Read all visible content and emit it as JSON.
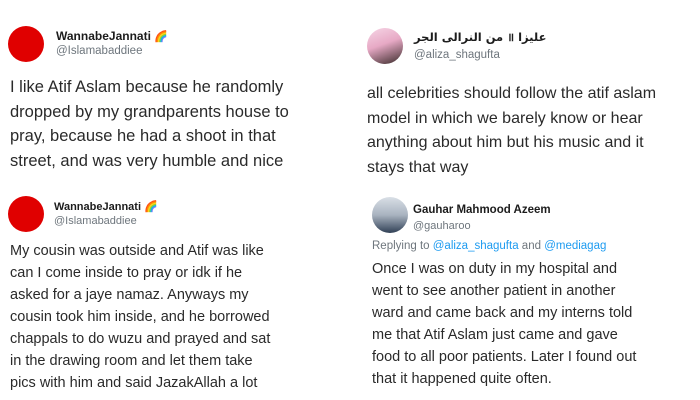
{
  "tweets": [
    {
      "name": "WannabeJannati",
      "badge": "🌈",
      "handle": "@Islamabaddiee",
      "lines": [
        "I like Atif Aslam because he randomly",
        "dropped by my grandparents house to",
        "pray, because he had a shoot in that",
        "street, and was very humble and nice"
      ]
    },
    {
      "name": "علیزا ॥ من النرالی الجر",
      "handle": "@aliza_shagufta",
      "lines": [
        "all celebrities should follow the atif aslam",
        "model in which we barely know or hear",
        "anything about him but his music and it",
        "stays that way"
      ]
    },
    {
      "name": "WannabeJannati",
      "badge": "🌈",
      "handle": "@Islamabaddiee",
      "lines": [
        "My cousin was outside and Atif was like",
        "can I come inside to pray or idk if he",
        "asked for a jaye namaz. Anyways my",
        "cousin took him inside, and he borrowed",
        "chappals to do wuzu and prayed and sat",
        "in the drawing room and let them take",
        "pics with him and said JazakAllah a lot"
      ]
    },
    {
      "name": "Gauhar Mahmood Azeem",
      "handle": "@gauharoo",
      "reply_prefix": "Replying to",
      "reply_to_1": "@aliza_shagufta",
      "reply_and": "and",
      "reply_to_2": "@mediagag",
      "lines": [
        "Once I was on duty in my hospital and",
        "went to see another patient in another",
        "ward and came back and my interns told",
        "me that Atif Aslam just came and gave",
        "food to all poor patients. Later I found out",
        "that it happened quite often."
      ]
    }
  ],
  "colors": {
    "link": "#1d9bf0",
    "handle": "#6e767d",
    "avatar_red": "#e00000"
  }
}
